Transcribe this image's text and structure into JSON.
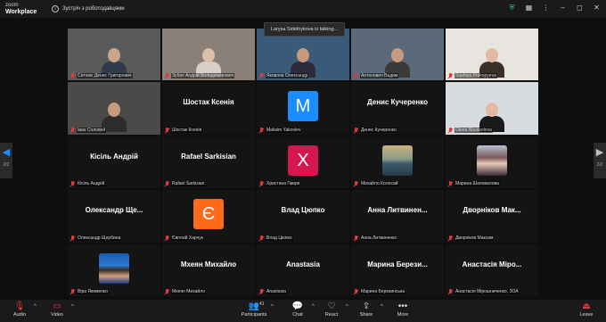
{
  "window": {
    "brand_top": "zoom",
    "brand_bottom": "Workplace",
    "meeting_title": "Зустріч з роботодавцями"
  },
  "talking_indicator": "Larysa Sidelnykova is talking...",
  "pagination": {
    "left": "2/2",
    "right": "2/2"
  },
  "tiles": [
    {
      "label": "Ситнюк Денис Григорович",
      "type": "video",
      "bg": "#5a5a5a",
      "skin": "#c9a58a",
      "shirt": "#2f3a4a"
    },
    {
      "label": "Зубач Андрій Володимирович",
      "type": "video",
      "bg": "#8a8078",
      "skin": "#d8c0aa",
      "shirt": "#d8d0c8"
    },
    {
      "label": "Яковлев Олександр",
      "type": "video",
      "bg": "#3a5a7a",
      "skin": "#c89a7a",
      "shirt": "#2a2a3a"
    },
    {
      "label": "Антонович Вадим",
      "type": "video",
      "bg": "#5a6a7a",
      "skin": "#c89a82",
      "shirt": "#3a3a3a"
    },
    {
      "label": "Sophiya Prokopyeva",
      "type": "video",
      "bg": "#e8e4e0",
      "skin": "#e0b9a0",
      "shirt": "#3a3028"
    },
    {
      "label": "Іван Соловей",
      "type": "video",
      "bg": "#4a4a48",
      "skin": "#c79a80",
      "shirt": "#2c2c2c"
    },
    {
      "label": "Шостак Ксенія",
      "type": "name",
      "name": "Шостак Ксенія"
    },
    {
      "label": "Maksim Yakovlev",
      "type": "avatar",
      "letter": "M",
      "color": "#1a8cff"
    },
    {
      "label": "Денис Кучеренко",
      "type": "name",
      "name": "Денис Кучеренко"
    },
    {
      "label": "Olena Novosolova",
      "type": "video",
      "bg": "#d8dce0",
      "skin": "#e2b8a0",
      "shirt": "#1a1a1a"
    },
    {
      "label": "Кісіль Андрій",
      "type": "name",
      "name": "Кісіль Андрій"
    },
    {
      "label": "Rafael Sarkisian",
      "type": "name",
      "name": "Rafael Sarkisian"
    },
    {
      "label": "Христина Гмиря",
      "type": "avatar",
      "letter": "Х",
      "color": "#d6174f"
    },
    {
      "label": "Михайло Колосай",
      "type": "picture",
      "pic": "sea"
    },
    {
      "label": "Марина Шаповалова",
      "type": "picture",
      "pic": "anime"
    },
    {
      "label": "Олександр Щербина",
      "type": "name",
      "name": "Олександр Ще..."
    },
    {
      "label": "Євгеній Харчук",
      "type": "avatar",
      "letter": "Є",
      "color": "#ff6a1a"
    },
    {
      "label": "Влад Цюпко",
      "type": "name",
      "name": "Влад Цюпко"
    },
    {
      "label": "Анна Литвиненко",
      "type": "name",
      "name": "Анна Литвинен..."
    },
    {
      "label": "Дворніков Максим",
      "type": "name",
      "name": "Дворніков Мак..."
    },
    {
      "label": "Віра Якименко",
      "type": "picture",
      "pic": "portrait"
    },
    {
      "label": "Мхеян Михайло",
      "type": "name",
      "name": "Мхеян Михайло"
    },
    {
      "label": "Anastasia",
      "type": "name",
      "name": "Anastasia"
    },
    {
      "label": "Марина Березинська",
      "type": "name",
      "name": "Марина Берези..."
    },
    {
      "label": "Анастасія Мірошниченко, ЗОА",
      "type": "name",
      "name": "Анастасія Міро..."
    }
  ],
  "toolbar": {
    "audio": "Audio",
    "video": "Video",
    "participants": "Participants",
    "participants_count": "41",
    "chat": "Chat",
    "react": "React",
    "share": "Share",
    "more": "More",
    "leave": "Leave"
  }
}
